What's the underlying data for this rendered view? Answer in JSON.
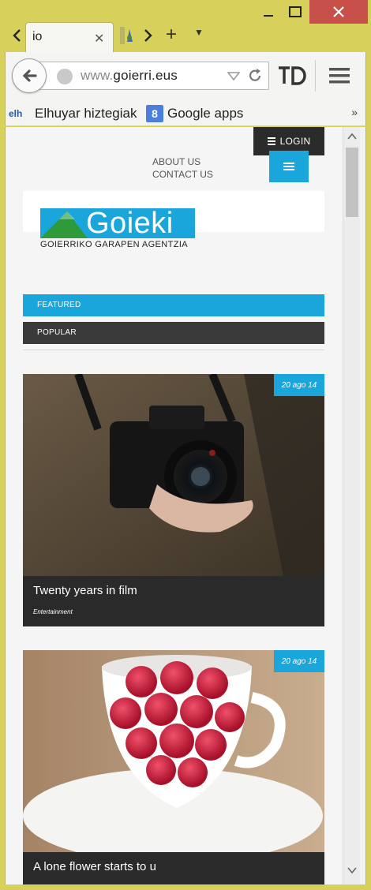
{
  "browser": {
    "tab_title": "io",
    "url_prefix": "www.",
    "url_domain": "goierri.eus",
    "bookmarks": [
      {
        "label": "Elhuyar hiztegiak",
        "icon": "elh"
      },
      {
        "label": "Google apps",
        "icon": "8"
      }
    ],
    "bookmarks_more": "»",
    "frame_color": "#d7d05a",
    "close_color": "#c7504a"
  },
  "site": {
    "login_label": "LOGIN",
    "top_links": [
      "ABOUT US",
      "CONTACT US"
    ],
    "logo_word": "Goieki",
    "logo_tagline": "GOIERRIKO GARAPEN AGENTZIA",
    "accent": "#1aa6db",
    "tabs": {
      "featured": "FEATURED",
      "popular": "POPULAR"
    },
    "posts": [
      {
        "date": "20 ago 14",
        "title": "Twenty years in film",
        "category": "Entertainment",
        "image": "camera-photo"
      },
      {
        "date": "20 ago 14",
        "title": "A lone flower starts to u",
        "category": "",
        "image": "raspberries-photo"
      }
    ]
  }
}
